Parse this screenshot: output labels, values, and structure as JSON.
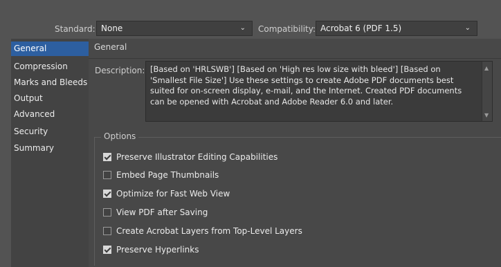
{
  "top": {
    "standard_label": "Standard:",
    "standard_value": "None",
    "compatibility_label": "Compatibility:",
    "compatibility_value": "Acrobat 6 (PDF 1.5)"
  },
  "sidebar": {
    "items": [
      {
        "label": "General",
        "active": true
      },
      {
        "label": "Compression",
        "active": false
      },
      {
        "label": "Marks and Bleeds",
        "active": false
      },
      {
        "label": "Output",
        "active": false
      },
      {
        "label": "Advanced",
        "active": false
      },
      {
        "label": "Security",
        "active": false
      },
      {
        "label": "Summary",
        "active": false
      }
    ]
  },
  "panel": {
    "title": "General",
    "description_label": "Description:",
    "description_text": "[Based on 'HRLSWB'] [Based on 'High res low size with bleed'] [Based on 'Smallest File Size'] Use these settings to create Adobe PDF documents best suited for on-screen display, e-mail, and the Internet.  Created PDF documents can be opened with Acrobat and Adobe Reader 6.0 and later.",
    "options_title": "Options",
    "options": [
      {
        "label": "Preserve Illustrator Editing Capabilities",
        "checked": true
      },
      {
        "label": "Embed Page Thumbnails",
        "checked": false
      },
      {
        "label": "Optimize for Fast Web View",
        "checked": true
      },
      {
        "label": "View PDF after Saving",
        "checked": false
      },
      {
        "label": "Create Acrobat Layers from Top-Level Layers",
        "checked": false
      },
      {
        "label": "Preserve Hyperlinks",
        "checked": true
      }
    ]
  },
  "colors": {
    "accent": "#2d5fa0",
    "background": "#535353",
    "panel": "#484848"
  }
}
